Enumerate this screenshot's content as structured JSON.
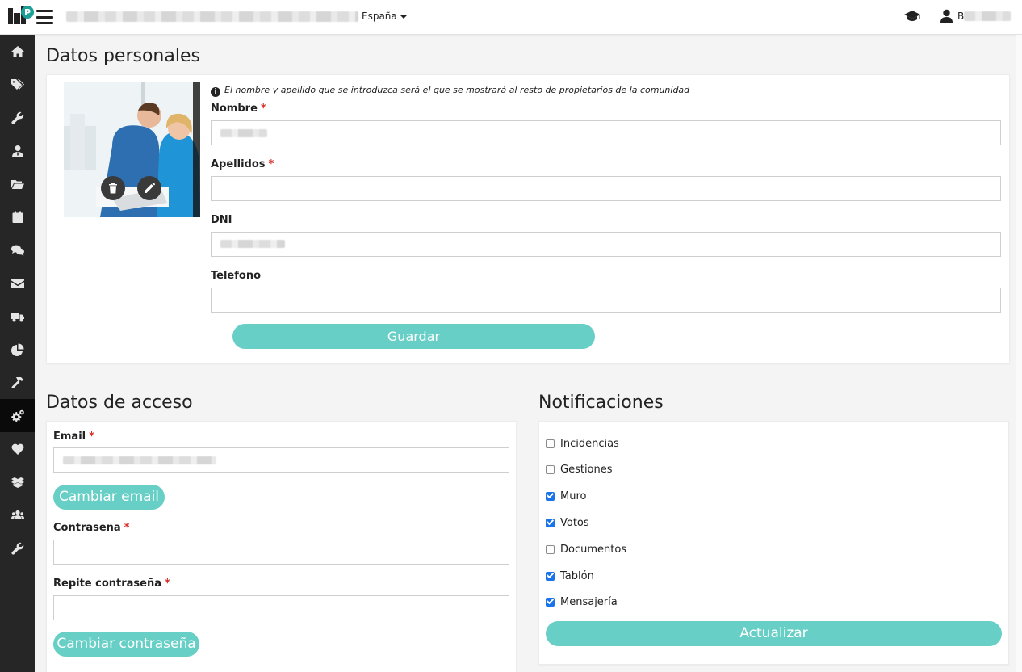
{
  "topbar": {
    "region_label": "España",
    "user_initial": "B"
  },
  "personal": {
    "title": "Datos personales",
    "info_text": "El nombre y apellido que se introduzca será el que se mostrará al resto de propietarios de la comunidad",
    "fields": [
      {
        "label": "Nombre",
        "required": "*",
        "value": ""
      },
      {
        "label": "Apellidos",
        "required": "*",
        "value": ""
      },
      {
        "label": "DNI",
        "required": "",
        "value": ""
      },
      {
        "label": "Telefono",
        "required": "",
        "value": ""
      }
    ],
    "save_label": "Guardar"
  },
  "access": {
    "title": "Datos de acceso",
    "email_label": "Email",
    "email_required": "*",
    "change_email_label": "Cambiar email",
    "password_label": "Contraseña",
    "password_required": "*",
    "repeat_password_label": "Repite contraseña",
    "repeat_required": "*",
    "change_password_label": "Cambiar contraseña"
  },
  "notifications": {
    "title": "Notificaciones",
    "items": [
      {
        "label": "Incidencias",
        "checked": false
      },
      {
        "label": "Gestiones",
        "checked": false
      },
      {
        "label": "Muro",
        "checked": true
      },
      {
        "label": "Votos",
        "checked": true
      },
      {
        "label": "Documentos",
        "checked": false
      },
      {
        "label": "Tablón",
        "checked": true
      },
      {
        "label": "Mensajería",
        "checked": true
      }
    ],
    "update_label": "Actualizar"
  },
  "sidebar": {
    "items": [
      {
        "icon": "home-icon"
      },
      {
        "icon": "tags-icon"
      },
      {
        "icon": "wrench-icon"
      },
      {
        "icon": "user-tie-icon"
      },
      {
        "icon": "folder-open-icon"
      },
      {
        "icon": "calendar-icon"
      },
      {
        "icon": "comments-icon"
      },
      {
        "icon": "envelope-icon"
      },
      {
        "icon": "truck-icon"
      },
      {
        "icon": "pie-chart-icon"
      },
      {
        "icon": "hammer-icon"
      },
      {
        "icon": "cogs-icon",
        "active": true
      },
      {
        "icon": "heart-icon"
      },
      {
        "icon": "box-open-icon"
      },
      {
        "icon": "users-icon"
      },
      {
        "icon": "wrench-icon"
      }
    ]
  },
  "colors": {
    "accent": "#67cfc6",
    "sidebar": "#262626",
    "required": "#d9302c",
    "checkbox": "#1a73e8"
  }
}
